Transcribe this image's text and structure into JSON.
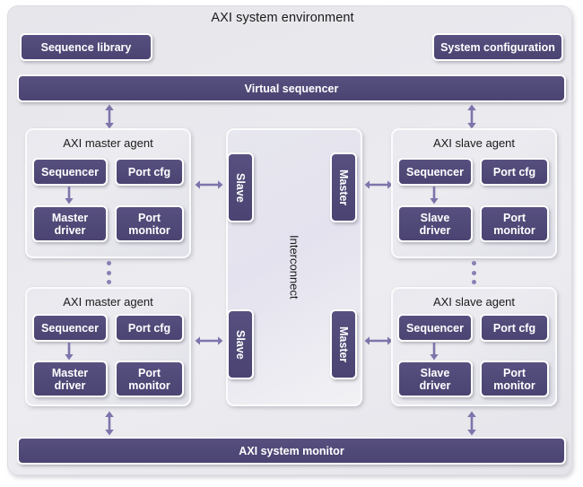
{
  "env": {
    "title": "AXI system environment",
    "accent_purple": "#504a78",
    "arrow_color": "#7e74ab",
    "panel_bg": "#e9e9ef",
    "frame_bg": "#e8e8ed"
  },
  "top_blocks": {
    "sequence_library": "Sequence library",
    "system_configuration": "System configuration",
    "virtual_sequencer": "Virtual sequencer"
  },
  "bottom_blocks": {
    "system_monitor": "AXI system monitor"
  },
  "master_agents": [
    {
      "title": "AXI master agent",
      "sequencer": "Sequencer",
      "port_cfg": "Port cfg",
      "driver": "Master\ndriver",
      "driver_line1": "Master",
      "driver_line2": "driver",
      "port_monitor_line1": "Port",
      "port_monitor_line2": "monitor"
    },
    {
      "title": "AXI master agent",
      "sequencer": "Sequencer",
      "port_cfg": "Port cfg",
      "driver_line1": "Master",
      "driver_line2": "driver",
      "port_monitor_line1": "Port",
      "port_monitor_line2": "monitor"
    }
  ],
  "slave_agents": [
    {
      "title": "AXI slave agent",
      "sequencer": "Sequencer",
      "port_cfg": "Port cfg",
      "driver_line1": "Slave",
      "driver_line2": "driver",
      "port_monitor_line1": "Port",
      "port_monitor_line2": "monitor"
    },
    {
      "title": "AXI slave agent",
      "sequencer": "Sequencer",
      "port_cfg": "Port cfg",
      "driver_line1": "Slave",
      "driver_line2": "driver",
      "port_monitor_line1": "Port",
      "port_monitor_line2": "monitor"
    }
  ],
  "interconnect": {
    "label": "Interconnect",
    "slave_ports": [
      "Slave",
      "Slave"
    ],
    "master_ports": [
      "Master",
      "Master"
    ]
  },
  "ellipsis": {
    "dots": "•••"
  }
}
